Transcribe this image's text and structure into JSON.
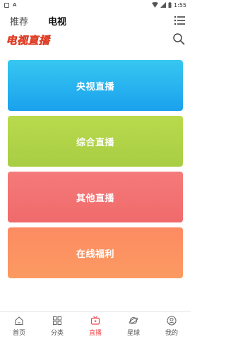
{
  "status": {
    "time": "1:55"
  },
  "tabs": [
    {
      "label": "推荐"
    },
    {
      "label": "电视"
    }
  ],
  "logo": "电视直播",
  "cards": [
    {
      "label": "央视直播",
      "color": "#1aa1ee"
    },
    {
      "label": "综合直播",
      "color": "#a8cd44"
    },
    {
      "label": "其他直播",
      "color": "#f06a6b"
    },
    {
      "label": "在线福利",
      "color": "#fc9562"
    }
  ],
  "nav": {
    "items": [
      {
        "label": "首页",
        "icon": "home-icon"
      },
      {
        "label": "分类",
        "icon": "grid-icon"
      },
      {
        "label": "直播",
        "icon": "tv-icon",
        "active": true
      },
      {
        "label": "星球",
        "icon": "planet-icon"
      },
      {
        "label": "我的",
        "icon": "user-icon"
      }
    ],
    "active_color": "#f2474a"
  }
}
